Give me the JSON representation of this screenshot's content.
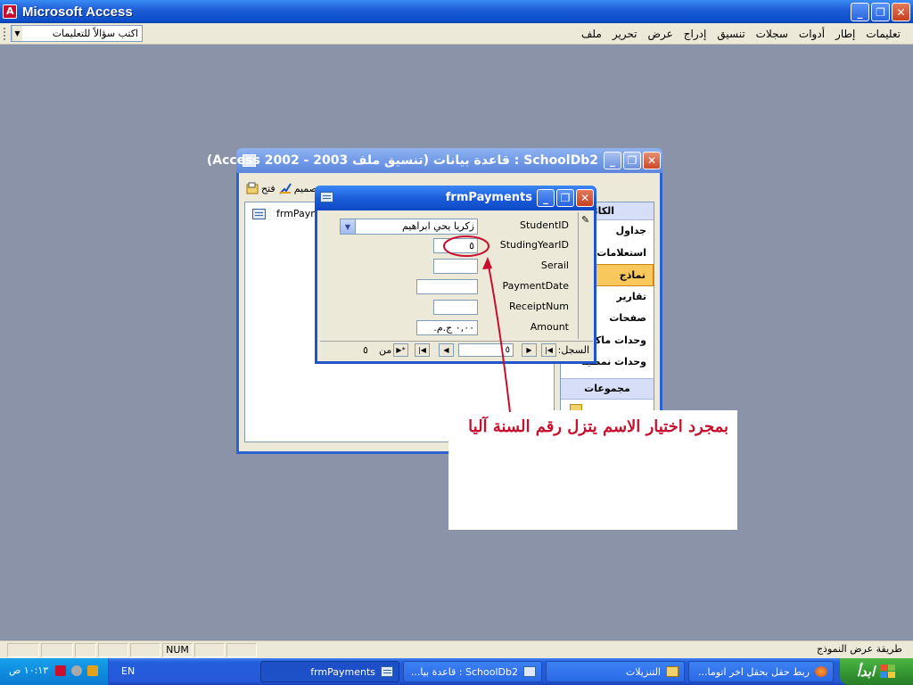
{
  "app": {
    "title": "Microsoft Access"
  },
  "window_buttons": {
    "minimize": "_",
    "maximize": "❐",
    "close": "✕"
  },
  "menubar": {
    "ask_placeholder": "اكتب سؤالاً للتعليمات",
    "items": [
      "ملف",
      "تحرير",
      "عرض",
      "إدراج",
      "تنسيق",
      "سجلات",
      "أدوات",
      "إطار",
      "تعليمات"
    ]
  },
  "dbwindow": {
    "title": "SchoolDb2 : قاعدة بيانات (تنسيق ملف Access 2002 - 2003)",
    "toolbar": {
      "open": "فتح",
      "design": "تصميم"
    },
    "list_item": "frmPayments",
    "objects_header": "الكائنات",
    "objects": [
      "جداول",
      "استعلامات",
      "نماذج",
      "تقارير",
      "صفحات",
      "وحدات ماكرو",
      "وحدات نمطية"
    ],
    "groups_header": "مجموعات",
    "favorites": "المفضلة"
  },
  "form": {
    "title": "frmPayments",
    "fields": [
      {
        "label": "StudentID",
        "value": "زكريا يحي ابراهيم"
      },
      {
        "label": "StudingYearID",
        "value": "٥"
      },
      {
        "label": "Serail",
        "value": ""
      },
      {
        "label": "PaymentDate",
        "value": ""
      },
      {
        "label": "ReceiptNum",
        "value": ""
      },
      {
        "label": "Amount",
        "value": "٠,٠٠ ج.م.‏"
      }
    ],
    "nav": {
      "label": "السجل:",
      "record": "٥",
      "of_label": "من",
      "count": "٥",
      "first": "|◀",
      "prev": "◀",
      "next": "▶",
      "last": "▶|",
      "new": "▶*"
    }
  },
  "callout": {
    "text": "بمجرد اختيار الاسم يتزل رقم السنة آليا"
  },
  "statusbar": {
    "text": "طريقة عرض النموذج",
    "num": "NUM"
  },
  "taskbar": {
    "start": "ابدأ",
    "buttons": [
      "ربط حقل بحقل اخر اتوما...",
      "التنزيلات",
      "SchoolDb2 : قاعدة بيا...",
      "frmPayments"
    ],
    "lang": "EN",
    "clock": "١٠:١٣ ص"
  },
  "colors": {
    "title_blue": "#0a4ec9",
    "annotation_red": "#c8102e",
    "selected_object": "#f8c85c",
    "desktop": "#8a93a8"
  }
}
